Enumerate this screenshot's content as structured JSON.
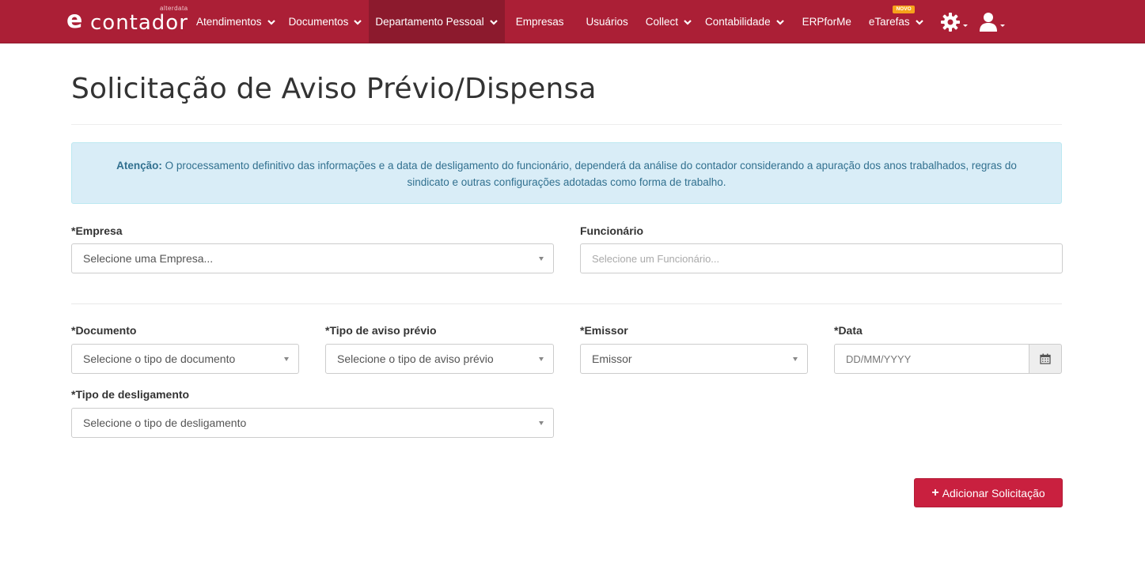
{
  "navbar": {
    "logo_mark": "e",
    "logo_word": "contador",
    "logo_sub": "alterdata",
    "items": [
      {
        "label": "Atendimentos",
        "dropdown": true
      },
      {
        "label": "Documentos",
        "dropdown": true
      },
      {
        "label": "Departamento Pessoal",
        "dropdown": true,
        "active": true
      },
      {
        "label": "Empresas",
        "dropdown": false
      },
      {
        "label": "Usuários",
        "dropdown": false
      },
      {
        "label": "Collect",
        "dropdown": true
      },
      {
        "label": "Contabilidade",
        "dropdown": true
      },
      {
        "label": "ERPforMe",
        "dropdown": false
      },
      {
        "label": "eTarefas",
        "dropdown": true,
        "badge": "NOVO"
      }
    ],
    "icons": [
      "gear-icon",
      "user-icon"
    ],
    "color": "#ab1f36",
    "active_color": "#8c1a2d"
  },
  "page": {
    "title": "Solicitação de Aviso Prévio/Dispensa"
  },
  "alert": {
    "strong": "Atenção:",
    "text": " O processamento definitivo das informações e a data de desligamento do funcionário, dependerá da análise do contador considerando a apuração dos anos trabalhados, regras do sindicato e outras configurações adotadas como forma de trabalho."
  },
  "form": {
    "empresa": {
      "label": "*Empresa",
      "placeholder": "Selecione uma Empresa..."
    },
    "funcionario": {
      "label": "Funcionário",
      "placeholder": "Selecione um Funcionário..."
    },
    "documento": {
      "label": "*Documento",
      "placeholder": "Selecione o tipo de documento"
    },
    "tipo_aviso": {
      "label": "*Tipo de aviso prévio",
      "placeholder": "Selecione o tipo de aviso prévio"
    },
    "emissor": {
      "label": "*Emissor",
      "placeholder": "Emissor"
    },
    "data": {
      "label": "*Data",
      "placeholder": "DD/MM/YYYY"
    },
    "tipo_desligamento": {
      "label": "*Tipo de desligamento",
      "placeholder": "Selecione o tipo de desligamento"
    }
  },
  "actions": {
    "add_label": "Adicionar Solicitação",
    "add_color": "#c9203f"
  }
}
